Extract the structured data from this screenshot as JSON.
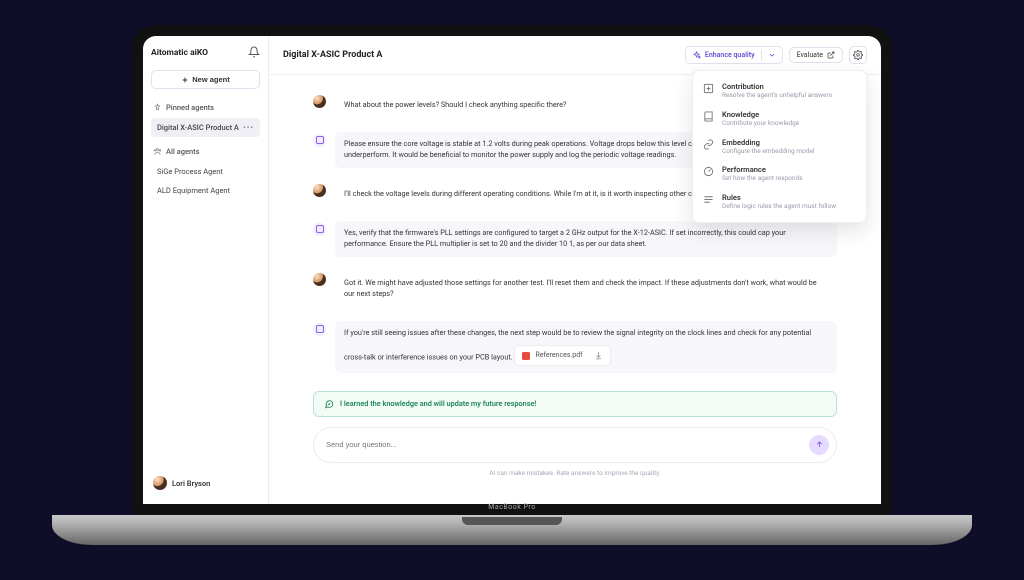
{
  "brand": "Aitomatic aiKO",
  "laptop_label": "MacBook Pro",
  "sidebar": {
    "new_agent": "New agent",
    "pinned_header": "Pinned agents",
    "all_header": "All agents",
    "pinned": [
      {
        "label": "Digital X-ASIC Product A",
        "active": true
      }
    ],
    "all": [
      {
        "label": "SiGe Process Agent"
      },
      {
        "label": "ALD Equipment Agent"
      }
    ]
  },
  "user": {
    "name": "Lori Bryson"
  },
  "header": {
    "title": "Digital X-ASIC Product A",
    "enhance_label": "Enhance quality",
    "evaluate_label": "Evaluate"
  },
  "dropdown": [
    {
      "icon": "plus-square",
      "title": "Contribution",
      "sub": "Resolve the agent's unhelpful answers"
    },
    {
      "icon": "book",
      "title": "Knowledge",
      "sub": "Contribute your knowledge"
    },
    {
      "icon": "link",
      "title": "Embedding",
      "sub": "Configure the embedding model"
    },
    {
      "icon": "gauge",
      "title": "Performance",
      "sub": "Set how the agent responds"
    },
    {
      "icon": "rules",
      "title": "Rules",
      "sub": "Define logic rules the agent must follow"
    }
  ],
  "messages": [
    {
      "role": "user",
      "text": "What about the power levels? Should I check anything specific there?"
    },
    {
      "role": "bot",
      "text": "Please ensure the core voltage is stable at 1.2 volts during peak operations. Voltage drops below this level could cause the X-12-ASIC to underperform. It would be beneficial to monitor the power supply and log the periodic voltage readings."
    },
    {
      "role": "user",
      "text": "I'll check the voltage levels during different operating conditions. While I'm at it, is it worth inspecting other critical components as well?"
    },
    {
      "role": "bot",
      "text": "Yes, verify that the firmware's PLL settings are configured to target a 2 GHz output for the X-12-ASIC. If set incorrectly, this could cap your performance. Ensure the PLL multiplier is set to 20 and the divider 10 1, as per our data sheet."
    },
    {
      "role": "user",
      "text": "Got it. We might have adjusted those settings for another test. I'll reset them and check the impact. If these adjustments don't work, what would be our next steps?"
    },
    {
      "role": "bot",
      "text": "If you're still seeing issues after these changes, the next step would be to review the signal integrity on the clock lines and check for any potential cross-talk or interference issues on your PCB layout.",
      "attachment": "References.pdf"
    }
  ],
  "learned_banner": "I learned the knowledge and will update my future response!",
  "input": {
    "placeholder": "Send your question..."
  },
  "footer_note": "AI can make mistakes. Rate answers to improve the quality."
}
